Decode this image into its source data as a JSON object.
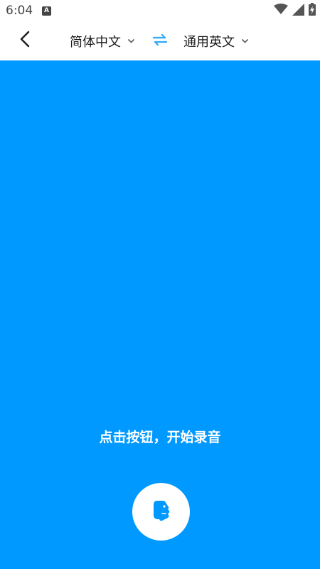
{
  "status_bar": {
    "time": "6:04",
    "notification_icon_letter": "A",
    "icons": [
      "wifi-icon",
      "cellular-signal-icon",
      "battery-charging-icon"
    ]
  },
  "header": {
    "back_icon": "chevron-left-icon",
    "source_language": "简体中文",
    "target_language": "通用英文",
    "swap_icon": "swap-arrows-icon",
    "dropdown_icon": "chevron-down-icon"
  },
  "main": {
    "hint": "点击按钮，开始录音",
    "record_icon": "speaking-head-icon"
  },
  "colors": {
    "accent": "#0099FF",
    "swap_icon": "#2FA8F5",
    "text_dark": "#1A1A1A",
    "background": "#FFFFFF"
  }
}
